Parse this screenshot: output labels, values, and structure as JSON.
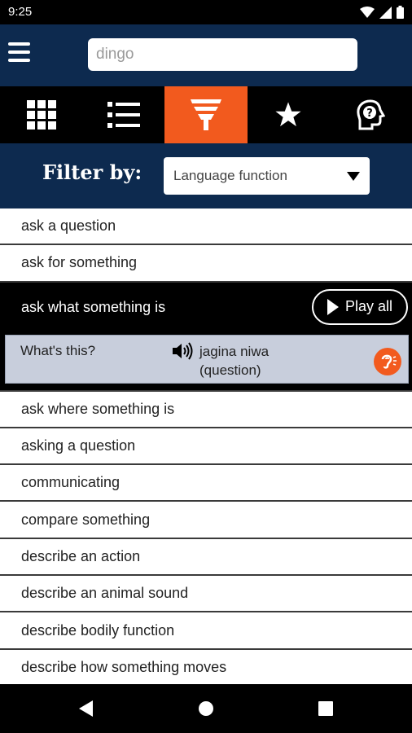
{
  "status_bar": {
    "time": "9:25"
  },
  "search": {
    "value": "",
    "placeholder": "dingo"
  },
  "tabs": [
    {
      "name": "grid-icon"
    },
    {
      "name": "list-icon"
    },
    {
      "name": "filter-icon",
      "active": true
    },
    {
      "name": "star-icon"
    },
    {
      "name": "head-question-icon"
    }
  ],
  "filter": {
    "label": "Filter by:",
    "selected": "Language function"
  },
  "list": {
    "items_top": [
      "ask a question",
      "ask for something"
    ],
    "expanded": {
      "label": "ask what something is",
      "play_all_label": "Play all",
      "phrase": {
        "english": "What's this?",
        "target_line1": "jagina niwa",
        "target_line2": "(question)"
      }
    },
    "items_bottom": [
      "ask where something is",
      "asking a question",
      "communicating",
      "compare something",
      "describe an action",
      "describe an animal sound",
      "describe bodily function",
      "describe how something moves"
    ]
  },
  "colors": {
    "header": "#0d2a4f",
    "accent": "#f25a1e",
    "phrase_bg": "#c8cedc"
  }
}
